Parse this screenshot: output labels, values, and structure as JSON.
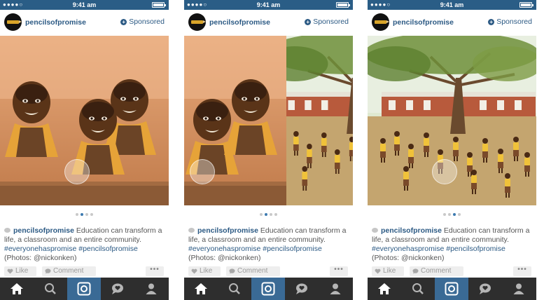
{
  "colors": {
    "status_bar": "#2a5d86",
    "link_blue": "#2c5a84",
    "tab_bar": "#2e2e2e",
    "tab_active": "#3a6a95"
  },
  "status_bar": {
    "signal": "●●●●○",
    "time": "9:41 am"
  },
  "posts": [
    {
      "username": "pencilsofpromise",
      "sponsored_label": "Sponsored",
      "photo": "classroom-children-close-up",
      "active_dot": 1,
      "caption": {
        "user": "pencilsofpromise",
        "text": " Education can transform a life, a classroom and an entire community. ",
        "hashtags": "#everyonehaspromise #pencilsofpromise",
        "credit": " (Photos: @nickonken)"
      },
      "like_label": "Like",
      "comment_label": "Comment",
      "more_label": "•••"
    },
    {
      "username": "pencilsofpromise",
      "sponsored_label": "Sponsored",
      "photo": "classroom-to-schoolyard-transition",
      "active_dot": 1,
      "caption": {
        "user": "pencilsofpromise",
        "text": " Education can transform a life, a classroom and an entire community. ",
        "hashtags": "#everyonehaspromise #pencilsofpromise",
        "credit": " (Photos: @nickonken)"
      },
      "like_label": "Like",
      "comment_label": "Comment",
      "more_label": "•••"
    },
    {
      "username": "pencilsofpromise",
      "sponsored_label": "Sponsored",
      "photo": "schoolyard-students-under-tree",
      "active_dot": 2,
      "caption": {
        "user": "pencilsofpromise",
        "text": " Education can transform a life, a classroom and an entire community. ",
        "hashtags": "#everyonehaspromise #pencilsofpromise",
        "credit": " (Photos: @nickonken)"
      },
      "like_label": "Like",
      "comment_label": "Comment",
      "more_label": "•••"
    }
  ],
  "tabs": [
    "home-icon",
    "search-icon",
    "camera-icon",
    "activity-icon",
    "profile-icon"
  ],
  "active_tab": 2
}
